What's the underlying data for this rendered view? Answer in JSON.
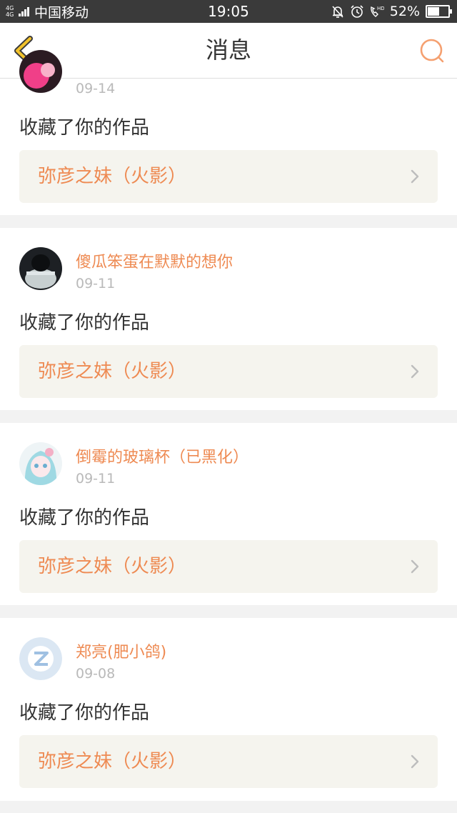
{
  "status_bar": {
    "network": "4G 4G",
    "carrier": "中国移动",
    "time": "19:05",
    "battery_percent": "52%",
    "battery_level": 0.52,
    "icons": [
      "bell-off-icon",
      "alarm-icon",
      "hd-call-icon"
    ]
  },
  "header": {
    "title": "消息",
    "back_icon": "chevron-left-icon",
    "search_icon": "search-icon",
    "accent_color": "#f5a070"
  },
  "messages": [
    {
      "user": "",
      "date": "09-14",
      "action": "收藏了你的作品",
      "work": "弥彦之妹（火影）"
    },
    {
      "user": "傻瓜笨蛋在默默的想你",
      "date": "09-11",
      "action": "收藏了你的作品",
      "work": "弥彦之妹（火影）"
    },
    {
      "user": "倒霉的玻璃杯（已黑化）",
      "date": "09-11",
      "action": "收藏了你的作品",
      "work": "弥彦之妹（火影）"
    },
    {
      "user": "郑亮(肥小鸽)",
      "date": "09-08",
      "action": "收藏了你的作品",
      "work": "弥彦之妹（火影）"
    }
  ],
  "colors": {
    "username": "#ee8a52",
    "work_title": "#ee8a52",
    "work_box_bg": "#f5f4ee",
    "date": "#b9b9b9"
  }
}
